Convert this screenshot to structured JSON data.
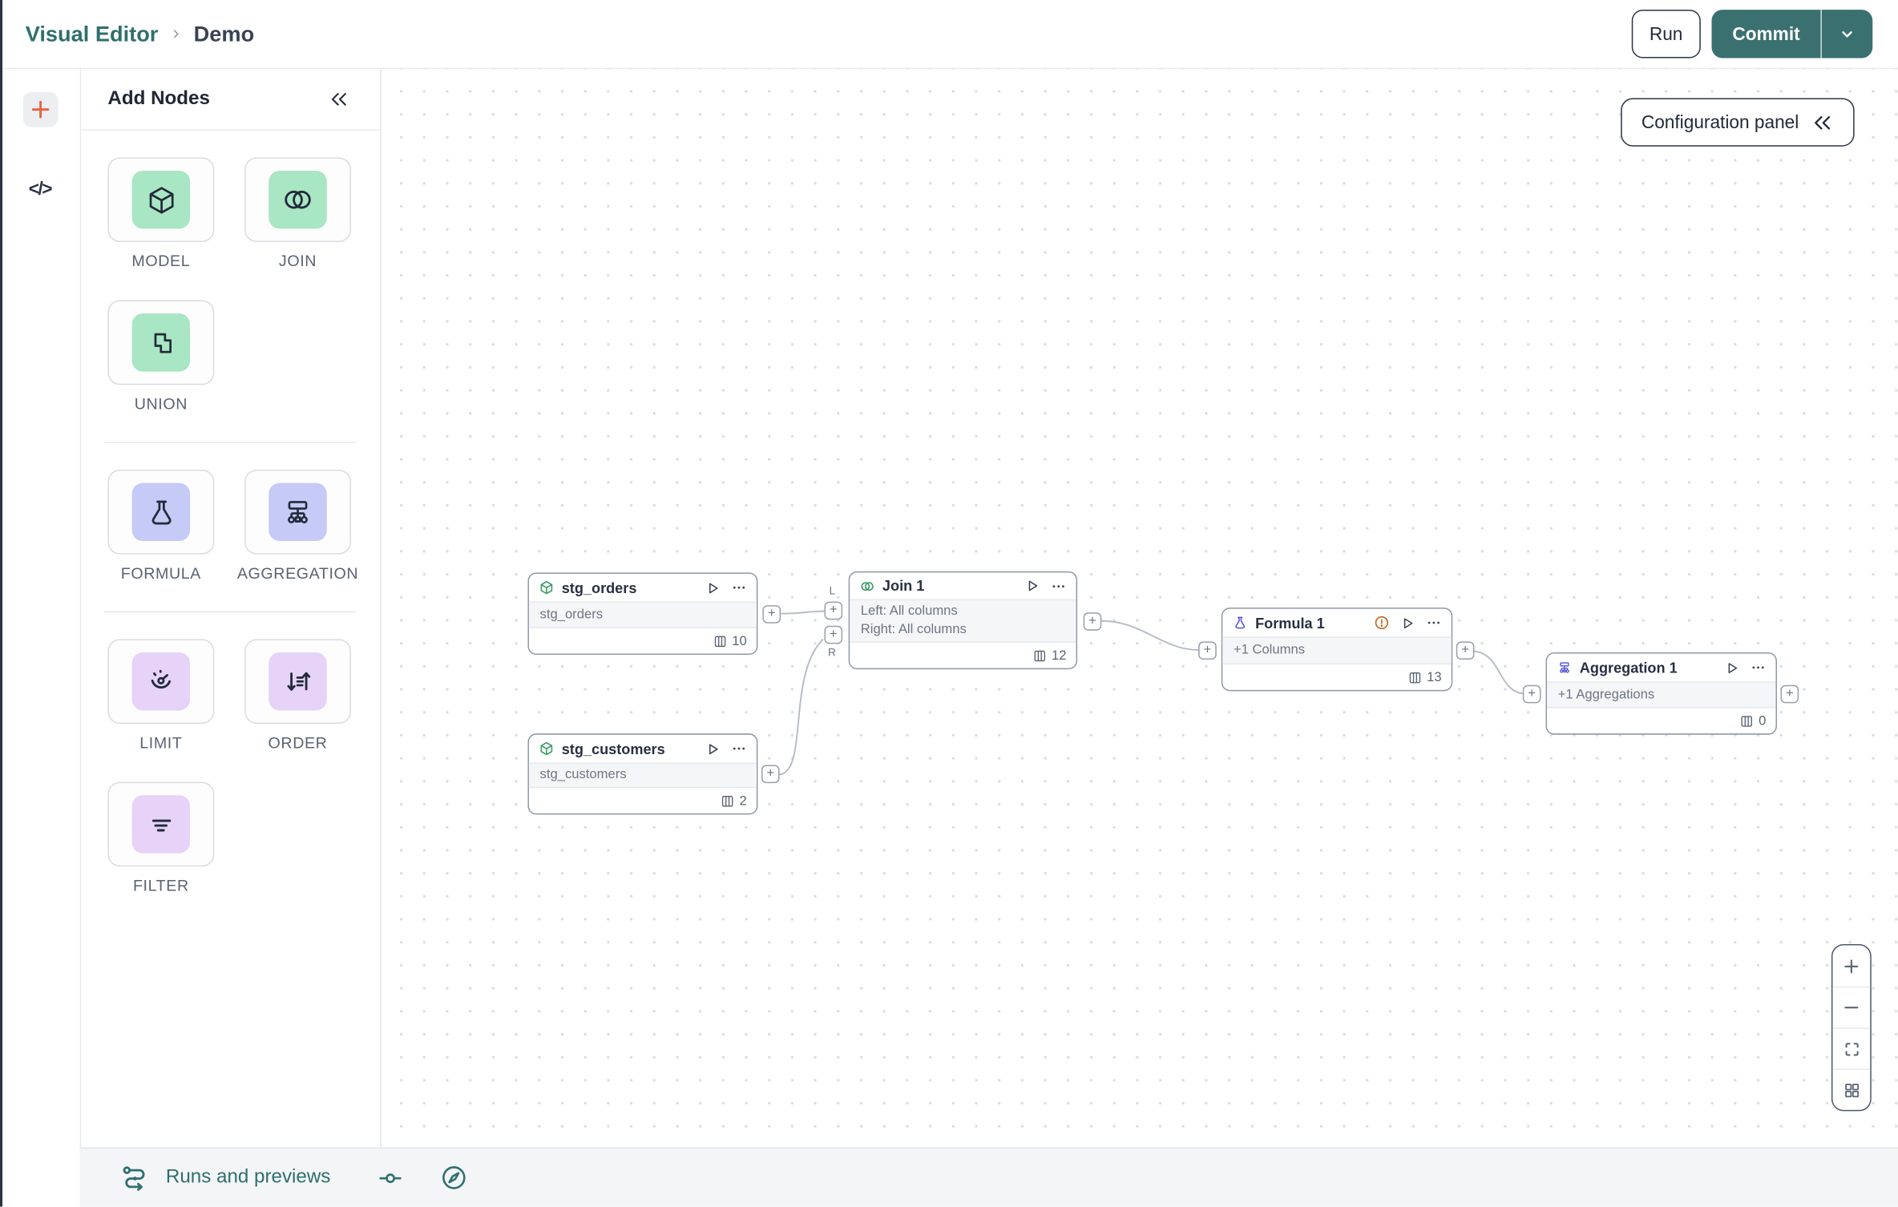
{
  "header": {
    "breadcrumb": {
      "section": "Visual Editor",
      "separator": "›",
      "page": "Demo"
    },
    "run_button": "Run",
    "commit_button": "Commit"
  },
  "left_rail": {
    "code_toggle": "</>"
  },
  "add_nodes_panel": {
    "title": "Add Nodes",
    "tiles": [
      {
        "label": "MODEL",
        "icon": "cube-icon"
      },
      {
        "label": "JOIN",
        "icon": "venn-icon"
      },
      {
        "label": "UNION",
        "icon": "union-icon"
      },
      {
        "label": "FORMULA",
        "icon": "flask-icon"
      },
      {
        "label": "AGGREGATION",
        "icon": "hierarchy-icon"
      },
      {
        "label": "LIMIT",
        "icon": "gauge-icon"
      },
      {
        "label": "ORDER",
        "icon": "sort-icon"
      },
      {
        "label": "FILTER",
        "icon": "filter-icon"
      }
    ]
  },
  "canvas": {
    "config_panel_button": {
      "label": "Configuration panel"
    },
    "handle_glyph": "+",
    "nodes": [
      {
        "title": "stg_orders",
        "icon": "cube-icon",
        "body_lines": [
          "stg_orders"
        ],
        "columns_count": "10"
      },
      {
        "title": "stg_customers",
        "icon": "cube-icon",
        "body_lines": [
          "stg_customers"
        ],
        "columns_count": "2"
      },
      {
        "title": "Join 1",
        "icon": "venn-icon",
        "body_lines": [
          "Left: All columns",
          "Right: All columns"
        ],
        "columns_count": "12",
        "input_labels": [
          "L",
          "R"
        ]
      },
      {
        "title": "Formula 1",
        "icon": "flask-icon",
        "body_lines": [
          "+1 Columns"
        ],
        "columns_count": "13",
        "has_warning": true
      },
      {
        "title": "Aggregation 1",
        "icon": "hierarchy-icon",
        "body_lines": [
          "+1 Aggregations"
        ],
        "columns_count": "0"
      }
    ]
  },
  "bottom_bar": {
    "label": "Runs and previews"
  },
  "colors": {
    "brand_teal": "#3A7170",
    "link_teal": "#2F6F6C",
    "accent_orange": "#E8613D",
    "node_green": "#3F9E68",
    "node_indigo": "#5C5CD6",
    "warning_orange": "#C2641C",
    "edge_grey": "#B7BDC6",
    "tile_green": "#A9E6C3",
    "tile_indigo": "#C5CAF6",
    "tile_lilac": "#E7D3F7"
  }
}
